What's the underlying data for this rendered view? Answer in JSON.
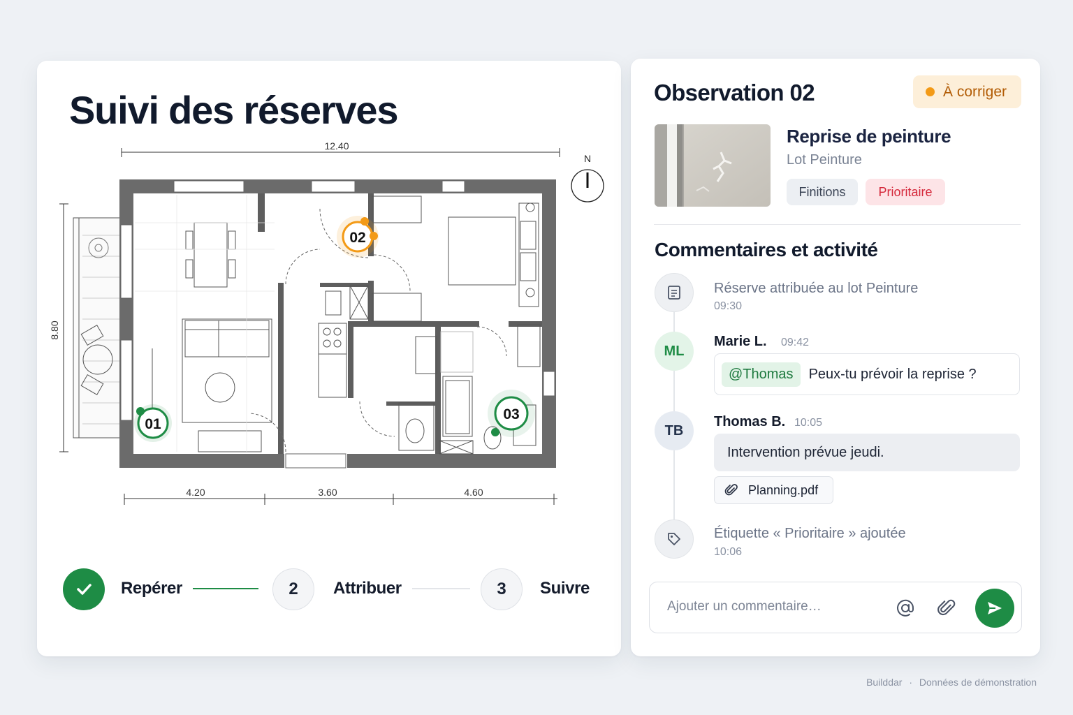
{
  "left": {
    "title": "Suivi des réserves",
    "plan": {
      "top_dimension": "12.40",
      "side_dimension": "8.80",
      "bottom_dimensions": [
        "4.20",
        "3.60",
        "4.60"
      ],
      "north_label": "N",
      "markers": [
        {
          "label": "01",
          "status": "done",
          "color": "#1e8c45"
        },
        {
          "label": "02",
          "status": "to-fix",
          "color": "#f39a16"
        },
        {
          "label": "03",
          "status": "done",
          "color": "#1e8c45"
        }
      ]
    },
    "stepper": {
      "steps": [
        {
          "number": "",
          "label": "Repérer",
          "state": "done"
        },
        {
          "number": "2",
          "label": "Attribuer",
          "state": "todo"
        },
        {
          "number": "3",
          "label": "Suivre",
          "state": "todo"
        }
      ]
    }
  },
  "right": {
    "observation_title": "Observation 02",
    "status_label": "À corriger",
    "issue_title": "Reprise de peinture",
    "issue_lot": "Lot Peinture",
    "tags": [
      "Finitions",
      "Prioritaire"
    ],
    "section_title": "Commentaires et activité",
    "activity": [
      {
        "type": "event",
        "icon": "document-icon",
        "text": "Réserve attribuée au lot Peinture",
        "time": "09:30"
      },
      {
        "type": "comment",
        "initials": "ML",
        "author": "Marie L.",
        "time": "09:42",
        "mention": "@Thomas",
        "text": "Peux-tu prévoir la reprise ?"
      },
      {
        "type": "comment",
        "initials": "TB",
        "author": "Thomas B.",
        "time": "10:05",
        "text": "Intervention prévue jeudi.",
        "attachment": "Planning.pdf"
      },
      {
        "type": "event",
        "icon": "tag-icon",
        "text": "Étiquette « Prioritaire » ajoutée",
        "time": "10:06"
      }
    ],
    "composer": {
      "placeholder": "Ajouter un commentaire…"
    }
  },
  "footer": {
    "brand": "Builddar",
    "separator": "·",
    "note": "Données de démonstration"
  },
  "colors": {
    "accent_green": "#1e8c45",
    "warning_orange": "#f39a16",
    "danger_red": "#d5283b"
  }
}
